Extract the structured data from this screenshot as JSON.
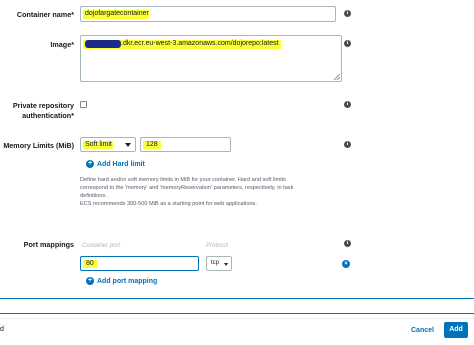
{
  "container_name": {
    "label": "Container name*",
    "value": "dojofargatecontainer",
    "info_icon": "info-icon"
  },
  "image": {
    "label": "Image*",
    "value_suffix": ".dkr.ecr.eu-west-3.amazonaws.com/dojorepo:latest"
  },
  "private_repo": {
    "label_line1": "Private repository",
    "label_line2": "authentication*",
    "checked": false
  },
  "memory_limits": {
    "label": "Memory Limits (MiB)",
    "limit_type": "Soft limit",
    "value": "128",
    "add_link": "Add Hard limit",
    "help": [
      "Define hard and/or soft memory limits in MiB for your container. Hard and soft limits",
      "correspond to the 'memory' and 'memoryReservation' parameters, respectively, in task",
      "definitions.",
      "ECS recommends 300-500 MiB as a starting point for web applications."
    ]
  },
  "port_mappings": {
    "label": "Port mappings",
    "container_port_placeholder": "Container port",
    "protocol_placeholder": "Protocol",
    "container_port_value": "80",
    "protocol": "tcp",
    "add_link": "Add port mapping"
  },
  "footer": {
    "left_char": "d",
    "cancel_label": "Cancel",
    "add_label": "Add"
  },
  "colors": {
    "highlight": "#fbff3a",
    "link": "#0073bb",
    "primary": "#0073bb"
  }
}
